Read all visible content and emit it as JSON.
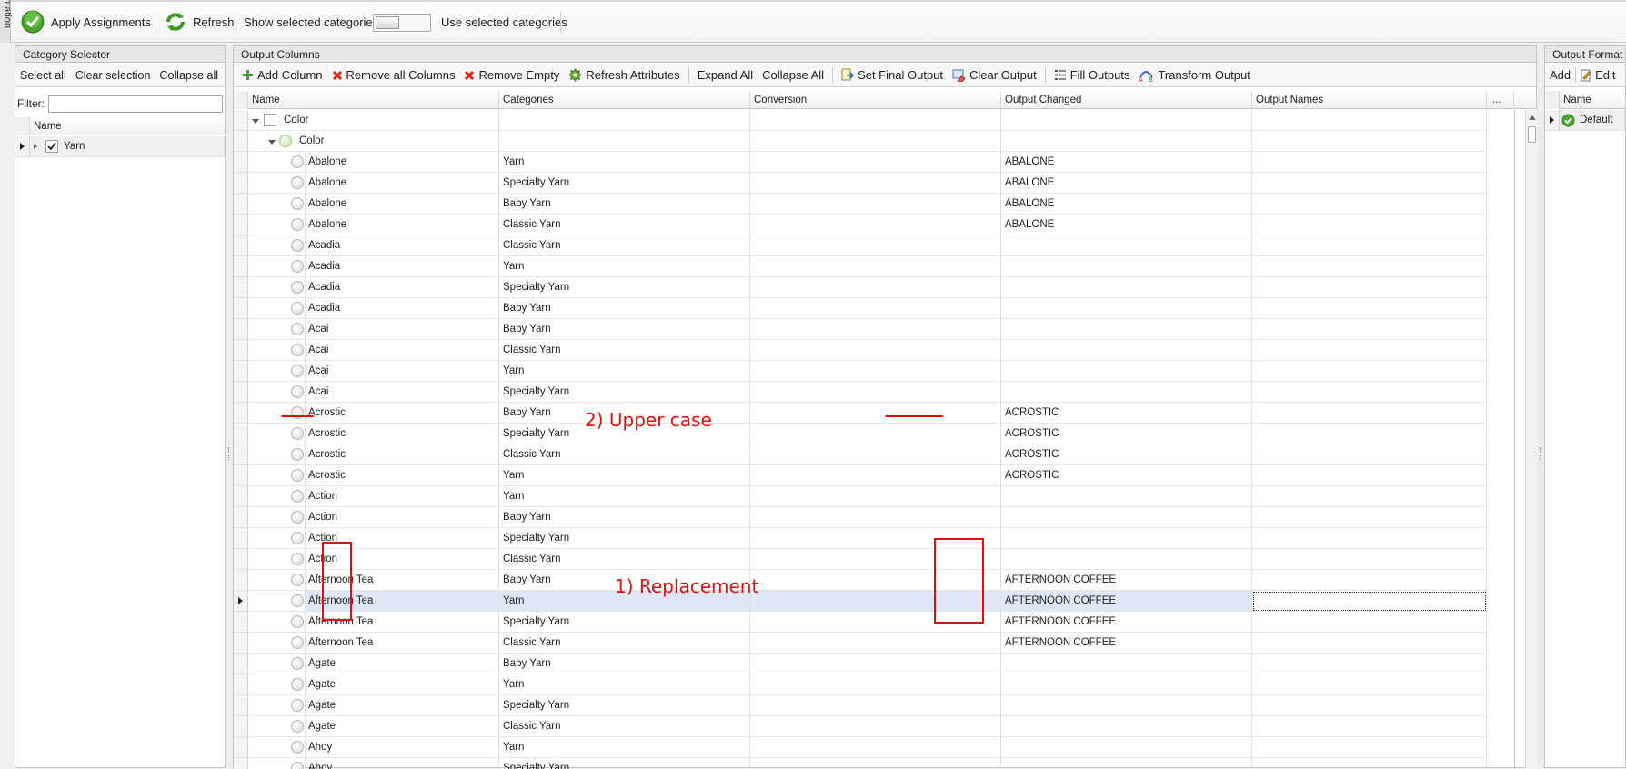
{
  "ribbon": {
    "vertical_tab": "ntation",
    "apply_assignments": "Apply Assignments",
    "refresh": "Refresh",
    "show_selected_categories": "Show selected categories",
    "use_selected_categories": "Use selected categories",
    "toggle_on": false
  },
  "category_selector": {
    "title": "Category Selector",
    "toolbar": {
      "select_all": "Select all",
      "clear_selection": "Clear selection",
      "collapse_all": "Collapse all"
    },
    "filter_label": "Filter:",
    "filter_value": "",
    "column_header": "Name",
    "items": [
      {
        "label": "Yarn",
        "checked": true
      }
    ]
  },
  "output_columns": {
    "title": "Output Columns",
    "toolbar": {
      "add_column": "Add Column",
      "remove_all_columns": "Remove all Columns",
      "remove_empty": "Remove Empty",
      "refresh_attributes": "Refresh Attributes",
      "expand_all": "Expand All",
      "collapse_all": "Collapse All",
      "set_final_output": "Set Final Output",
      "clear_output": "Clear Output",
      "fill_outputs": "Fill Outputs",
      "transform_output": "Transform Output"
    },
    "columns": {
      "name": "Name",
      "categories": "Categories",
      "conversion": "Conversion",
      "output_changed": "Output Changed",
      "output_names": "Output Names",
      "more": "..."
    },
    "group_level1": "Color",
    "group_level2": "Color",
    "rows": [
      {
        "name": "Abalone",
        "category": "Yarn",
        "output": "ABALONE"
      },
      {
        "name": "Abalone",
        "category": "Specialty Yarn",
        "output": "ABALONE"
      },
      {
        "name": "Abalone",
        "category": "Baby Yarn",
        "output": "ABALONE"
      },
      {
        "name": "Abalone",
        "category": "Classic Yarn",
        "output": "ABALONE"
      },
      {
        "name": "Acadia",
        "category": "Classic Yarn",
        "output": ""
      },
      {
        "name": "Acadia",
        "category": "Yarn",
        "output": ""
      },
      {
        "name": "Acadia",
        "category": "Specialty Yarn",
        "output": ""
      },
      {
        "name": "Acadia",
        "category": "Baby Yarn",
        "output": ""
      },
      {
        "name": "Acai",
        "category": "Baby Yarn",
        "output": ""
      },
      {
        "name": "Acai",
        "category": "Classic Yarn",
        "output": ""
      },
      {
        "name": "Acai",
        "category": "Yarn",
        "output": ""
      },
      {
        "name": "Acai",
        "category": "Specialty Yarn",
        "output": ""
      },
      {
        "name": "Acrostic",
        "category": "Baby Yarn",
        "output": "ACROSTIC"
      },
      {
        "name": "Acrostic",
        "category": "Specialty Yarn",
        "output": "ACROSTIC"
      },
      {
        "name": "Acrostic",
        "category": "Classic Yarn",
        "output": "ACROSTIC"
      },
      {
        "name": "Acrostic",
        "category": "Yarn",
        "output": "ACROSTIC"
      },
      {
        "name": "Action",
        "category": "Yarn",
        "output": ""
      },
      {
        "name": "Action",
        "category": "Baby Yarn",
        "output": ""
      },
      {
        "name": "Action",
        "category": "Specialty Yarn",
        "output": ""
      },
      {
        "name": "Action",
        "category": "Classic Yarn",
        "output": ""
      },
      {
        "name": "Afternoon Tea",
        "category": "Baby Yarn",
        "output": "AFTERNOON COFFEE"
      },
      {
        "name": "Afternoon Tea",
        "category": "Yarn",
        "output": "AFTERNOON COFFEE",
        "selected": true
      },
      {
        "name": "Afternoon Tea",
        "category": "Specialty Yarn",
        "output": "AFTERNOON COFFEE"
      },
      {
        "name": "Afternoon Tea",
        "category": "Classic Yarn",
        "output": "AFTERNOON COFFEE"
      },
      {
        "name": "Agate",
        "category": "Baby Yarn",
        "output": ""
      },
      {
        "name": "Agate",
        "category": "Yarn",
        "output": ""
      },
      {
        "name": "Agate",
        "category": "Specialty Yarn",
        "output": ""
      },
      {
        "name": "Agate",
        "category": "Classic Yarn",
        "output": ""
      },
      {
        "name": "Ahoy",
        "category": "Yarn",
        "output": ""
      },
      {
        "name": "Ahoy",
        "category": "Specialty Yarn",
        "output": ""
      }
    ]
  },
  "output_format": {
    "title": "Output Format Se",
    "toolbar": {
      "add": "Add",
      "edit": "Edit"
    },
    "column_header": "Name",
    "items": [
      {
        "label": "Default"
      }
    ]
  },
  "annotations": {
    "replacement": "1) Replacement",
    "upper_case": "2) Upper case"
  },
  "colors": {
    "annotation_red": "#e01010",
    "selection": "#dfe7f6"
  }
}
